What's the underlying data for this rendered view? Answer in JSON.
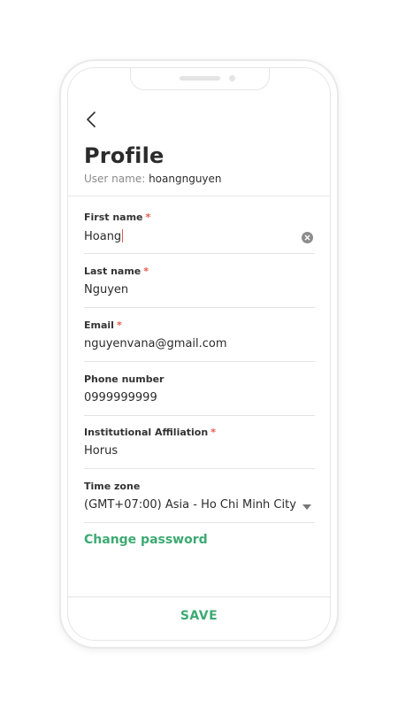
{
  "header": {
    "title": "Profile",
    "username_label": "User name:",
    "username_value": "hoangnguyen"
  },
  "form": {
    "required_mark": "*",
    "first_name": {
      "label": "First name",
      "value": "Hoang",
      "required": true
    },
    "last_name": {
      "label": "Last name",
      "value": "Nguyen",
      "required": true
    },
    "email": {
      "label": "Email",
      "value": "nguyenvana@gmail.com",
      "required": true
    },
    "phone": {
      "label": "Phone number",
      "value": "0999999999",
      "required": false
    },
    "affiliation": {
      "label": "Institutional Affiliation",
      "value": "Horus",
      "required": true
    },
    "timezone": {
      "label": "Time zone",
      "value": "(GMT+07:00) Asia - Ho Chi Minh City",
      "required": false
    }
  },
  "actions": {
    "change_password": "Change password",
    "save": "SAVE"
  },
  "icons": {
    "back": "chevron-left-icon",
    "clear": "clear-circle-icon",
    "dropdown": "caret-down-icon"
  },
  "colors": {
    "accent": "#3daa73",
    "required": "#e8584a",
    "text": "#2b2b2b",
    "muted": "#8a8a8a"
  }
}
